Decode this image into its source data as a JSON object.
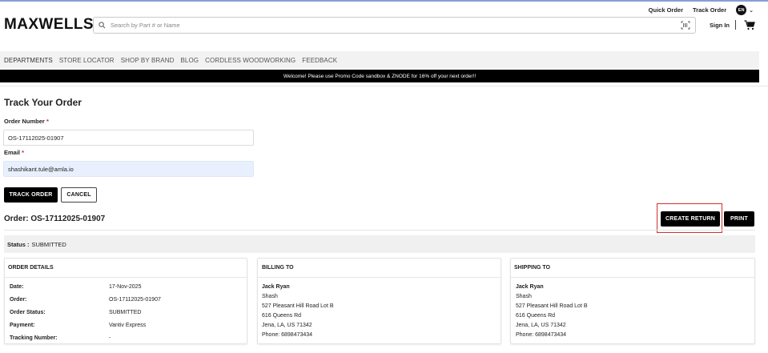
{
  "utility": {
    "quick_order": "Quick Order",
    "track_order": "Track Order",
    "language": "EN"
  },
  "header": {
    "logo": "MAXWELLS",
    "search_placeholder": "Search by Part # or Name",
    "sign_in": "Sign In"
  },
  "nav": {
    "items": [
      "DEPARTMENTS",
      "STORE LOCATOR",
      "SHOP BY BRAND",
      "BLOG",
      "CORDLESS WOODWORKING",
      "FEEDBACK"
    ]
  },
  "promo": "Welcome! Please use Promo Code sandbox & ZNODE for 16% off your next order!!",
  "form": {
    "title": "Track Your Order",
    "order_number_label": "Order Number",
    "order_number_value": "OS-17112025-01907",
    "email_label": "Email",
    "email_value": "shashikant.tule@amla.io",
    "required_mark": "*",
    "track_button": "TRACK ORDER",
    "cancel_button": "CANCEL"
  },
  "order": {
    "title": "Order: OS-17112025-01907",
    "create_return": "CREATE RETURN",
    "print": "PRINT",
    "status_label": "Status :",
    "status_value": "SUBMITTED"
  },
  "order_details": {
    "heading": "ORDER DETAILS",
    "rows": [
      {
        "k": "Date:",
        "v": "17-Nov-2025"
      },
      {
        "k": "Order:",
        "v": "OS-17112025-01907"
      },
      {
        "k": "Order Status:",
        "v": "SUBMITTED"
      },
      {
        "k": "Payment:",
        "v": "Vantiv Express"
      },
      {
        "k": "Tracking Number:",
        "v": "-"
      }
    ]
  },
  "billing": {
    "heading": "BILLING TO",
    "name": "Jack Ryan",
    "company": "Shash",
    "line1": "527 Pleasant Hill Road Lot B",
    "line2": "616 Queens Rd",
    "city": "Jena, LA, US 71342",
    "phone": "Phone: 6898473434"
  },
  "shipping": {
    "heading": "SHIPPING TO",
    "name": "Jack Ryan",
    "company": "Shash",
    "line1": "527 Pleasant Hill Road Lot B",
    "line2": "616 Queens Rd",
    "city": "Jena, LA, US 71342",
    "phone": "Phone: 6898473434"
  },
  "colors": {
    "primary": "#000000",
    "highlight": "#d32f2f",
    "required": "#c62828",
    "autofill": "#e8f0fe"
  }
}
